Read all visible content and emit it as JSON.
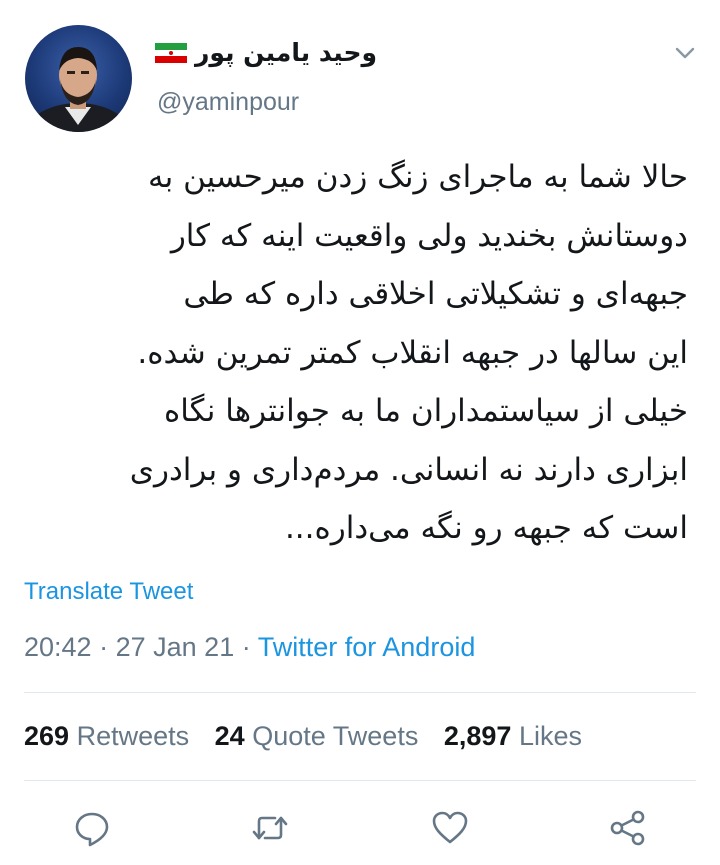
{
  "author": {
    "display_name": "وحید یامین پور",
    "handle": "@yaminpour",
    "flag_icon": "iran-flag-icon"
  },
  "tweet": {
    "text": "حالا شما به ماجرای زنگ زدن میرحسین به\nدوستانش بخندید ولی واقعیت اینه که کار\nجبهه‌ای و تشکیلاتی اخلاقی داره که طی\nاین سالها در جبهه انقلاب کمتر تمرین شده.\nخیلی از سیاستمداران ما به جوانترها نگاه\nابزاری دارند نه انسانی. مردم‌داری و برادری\nاست که جبهه رو نگه می‌داره...",
    "translate_label": "Translate Tweet",
    "time": "20:42",
    "date": "27 Jan 21",
    "separator": "·",
    "source": "Twitter for Android"
  },
  "stats": {
    "retweets_count": "269",
    "retweets_label": "Retweets",
    "quote_count": "24",
    "quote_label": "Quote Tweets",
    "likes_count": "2,897",
    "likes_label": "Likes"
  },
  "actions": [
    "reply-icon",
    "retweet-icon",
    "like-icon",
    "share-icon"
  ],
  "colors": {
    "text": "#14171a",
    "secondary": "#657786",
    "link": "#1b95e0",
    "divider": "#e1e8ed"
  }
}
